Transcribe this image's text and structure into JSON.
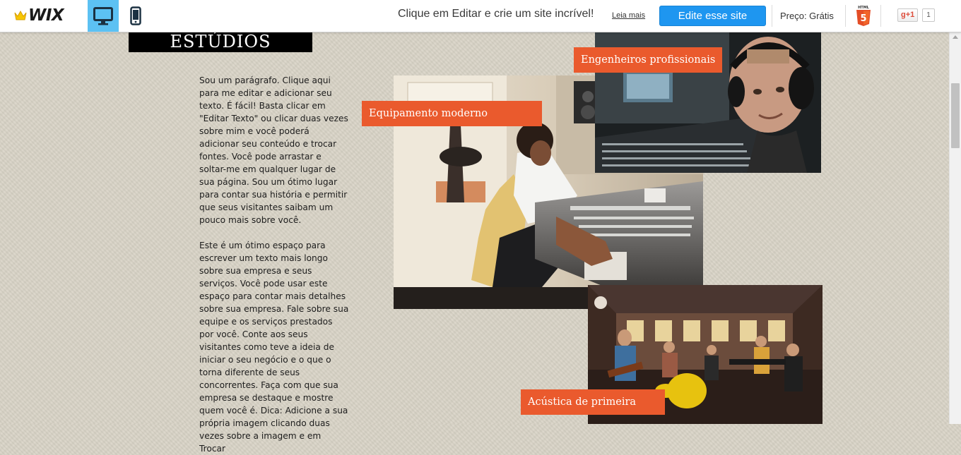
{
  "topbar": {
    "logo_text": "WIX",
    "promo_text": "Clique em Editar e crie um site incrível!",
    "learn_more": "Leia mais",
    "edit_button": "Edite esse site",
    "price_text": "Preço: Grátis",
    "html5_badge": "HTML 5",
    "gplus_label": "g+1",
    "gplus_count": "1",
    "active_view": "desktop",
    "accent_color": "#1e96f0",
    "desktop_view_color": "#5cc1f3"
  },
  "content": {
    "section_title": "ESTÚDIOS",
    "paragraph_1": "Sou um parágrafo. Clique aqui para me editar e adicionar seu texto. É fácil! Basta clicar em \"Editar Texto\" ou clicar duas vezes sobre mim e você poderá adicionar seu conteúdo e trocar fontes. Você pode arrastar e soltar-me em qualquer lugar de sua página. Sou um ótimo lugar para contar sua história e permitir que seus visitantes saibam um pouco mais sobre você.",
    "paragraph_2": "Este é um ótimo espaço para escrever um texto mais longo sobre sua empresa e seus serviços. Você pode usar este espaço para contar mais detalhes sobre sua empresa. Fale sobre sua equipe e os serviços prestados por você. Conte aos seus visitantes como teve a ideia de iniciar o seu negócio e o que o torna diferente de seus concorrentes. Faça com que sua empresa se destaque e mostre quem você é. Dica: Adicione a sua própria imagem clicando duas vezes sobre a imagem e em Trocar",
    "tags": {
      "equipment": "Equipamento moderno",
      "engineers": "Engenheiros profissionais",
      "acoustics": "Acústica de primeira"
    },
    "tag_color": "#ea5a2d"
  }
}
